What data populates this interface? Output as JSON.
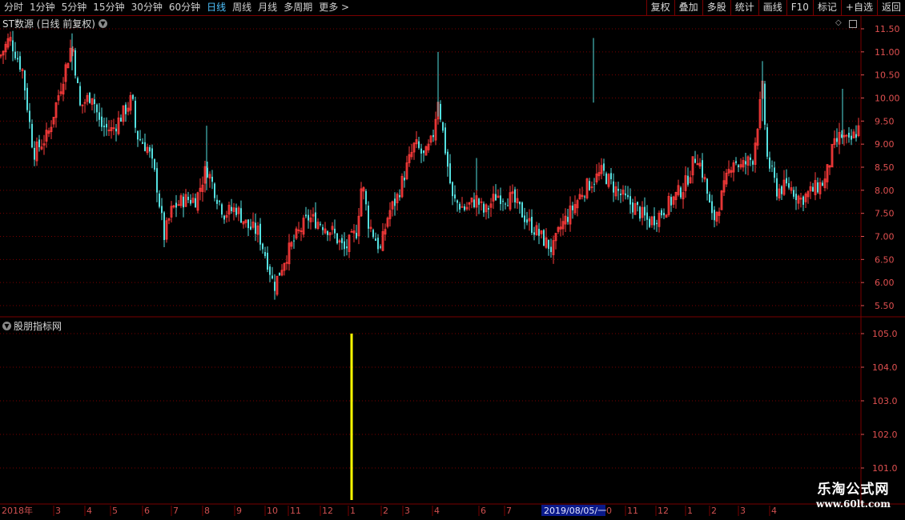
{
  "toolbar": {
    "tabs": [
      "分时",
      "1分钟",
      "5分钟",
      "15分钟",
      "30分钟",
      "60分钟",
      "日线",
      "周线",
      "月线",
      "多周期",
      "更多 >"
    ],
    "active_tab": "日线",
    "buttons": [
      "复权",
      "叠加",
      "多股",
      "统计",
      "画线",
      "F10",
      "标记",
      "+自选",
      "返回"
    ]
  },
  "main_pane": {
    "title": "ST数源 (日线 前复权)",
    "price_axis": [
      "11.50",
      "11.00",
      "10.50",
      "10.00",
      "9.50",
      "9.00",
      "8.50",
      "8.00",
      "7.50",
      "7.00",
      "6.50",
      "6.00",
      "5.50"
    ]
  },
  "indicator_pane": {
    "title": "股朋指标网",
    "value_axis": [
      "105.0",
      "104.0",
      "103.0",
      "102.0",
      "101.0"
    ]
  },
  "date_axis": {
    "year_label": "2018年",
    "months": [
      "3",
      "4",
      "5",
      "6",
      "7",
      "8",
      "9",
      "10",
      "11",
      "12",
      "1",
      "2",
      "3",
      "4",
      "6",
      "7",
      "0",
      "11",
      "12",
      "1",
      "2",
      "3",
      "4"
    ],
    "cursor_date": "2019/08/05/一"
  },
  "watermark": {
    "title": "乐淘公式网",
    "url": "www.60lt.com"
  },
  "colors": {
    "up": "#ff3b3b",
    "down": "#54e0e0",
    "grid": "#7a0000",
    "axis": "#e05050",
    "indicator": "#ffff00",
    "active_tab": "#4fc3ff"
  },
  "chart_data": [
    {
      "type": "candlestick",
      "title": "ST数源 (日线 前复权)",
      "ylim": [
        5.4,
        11.7
      ],
      "x_ticks": [
        "2018年",
        "3",
        "4",
        "5",
        "6",
        "7",
        "8",
        "9",
        "10",
        "11",
        "12",
        "1",
        "2",
        "3",
        "4",
        "6",
        "7",
        "11",
        "12",
        "1",
        "2",
        "3",
        "4"
      ],
      "close_path": [
        [
          0,
          10.9
        ],
        [
          12,
          11.3
        ],
        [
          28,
          10.6
        ],
        [
          42,
          8.8
        ],
        [
          60,
          9.2
        ],
        [
          72,
          10.0
        ],
        [
          90,
          11.2
        ],
        [
          100,
          9.8
        ],
        [
          115,
          10.1
        ],
        [
          125,
          9.4
        ],
        [
          140,
          9.3
        ],
        [
          155,
          9.7
        ],
        [
          165,
          10.0
        ],
        [
          170,
          9.2
        ],
        [
          185,
          8.9
        ],
        [
          195,
          8.2
        ],
        [
          205,
          7.0
        ],
        [
          215,
          7.6
        ],
        [
          230,
          7.8
        ],
        [
          245,
          7.8
        ],
        [
          258,
          8.5
        ],
        [
          270,
          7.9
        ],
        [
          280,
          7.5
        ],
        [
          295,
          7.6
        ],
        [
          310,
          7.2
        ],
        [
          322,
          7.1
        ],
        [
          335,
          6.4
        ],
        [
          342,
          5.9
        ],
        [
          355,
          6.5
        ],
        [
          370,
          7.0
        ],
        [
          385,
          7.4
        ],
        [
          400,
          7.3
        ],
        [
          415,
          7.1
        ],
        [
          430,
          6.7
        ],
        [
          445,
          7.1
        ],
        [
          452,
          8.2
        ],
        [
          460,
          7.3
        ],
        [
          475,
          6.7
        ],
        [
          485,
          7.5
        ],
        [
          495,
          7.8
        ],
        [
          508,
          8.5
        ],
        [
          518,
          9.0
        ],
        [
          530,
          8.7
        ],
        [
          540,
          9.1
        ],
        [
          547,
          10.0
        ],
        [
          555,
          9.0
        ],
        [
          565,
          7.8
        ],
        [
          580,
          7.6
        ],
        [
          595,
          7.8
        ],
        [
          605,
          7.5
        ],
        [
          620,
          7.9
        ],
        [
          640,
          7.8
        ],
        [
          660,
          7.3
        ],
        [
          675,
          7.0
        ],
        [
          690,
          6.7
        ],
        [
          700,
          7.2
        ],
        [
          715,
          7.6
        ],
        [
          728,
          8.0
        ],
        [
          740,
          8.2
        ],
        [
          752,
          8.4
        ],
        [
          765,
          8.1
        ],
        [
          780,
          7.8
        ],
        [
          795,
          7.6
        ],
        [
          810,
          7.3
        ],
        [
          825,
          7.5
        ],
        [
          840,
          7.8
        ],
        [
          855,
          8.1
        ],
        [
          870,
          8.8
        ],
        [
          880,
          8.2
        ],
        [
          890,
          7.3
        ],
        [
          900,
          7.8
        ],
        [
          915,
          8.7
        ],
        [
          925,
          8.5
        ],
        [
          940,
          8.7
        ],
        [
          952,
          10.2
        ],
        [
          958,
          8.7
        ],
        [
          970,
          8.0
        ],
        [
          985,
          8.1
        ],
        [
          1000,
          7.8
        ],
        [
          1015,
          8.0
        ],
        [
          1030,
          8.2
        ],
        [
          1040,
          8.9
        ],
        [
          1050,
          9.2
        ],
        [
          1060,
          9.0
        ],
        [
          1074,
          9.4
        ]
      ]
    },
    {
      "type": "bar",
      "title": "股朋指标网",
      "ylim": [
        100.6,
        105.3
      ],
      "bars": [
        {
          "x": "2019/1",
          "value": 105.0
        }
      ]
    }
  ]
}
